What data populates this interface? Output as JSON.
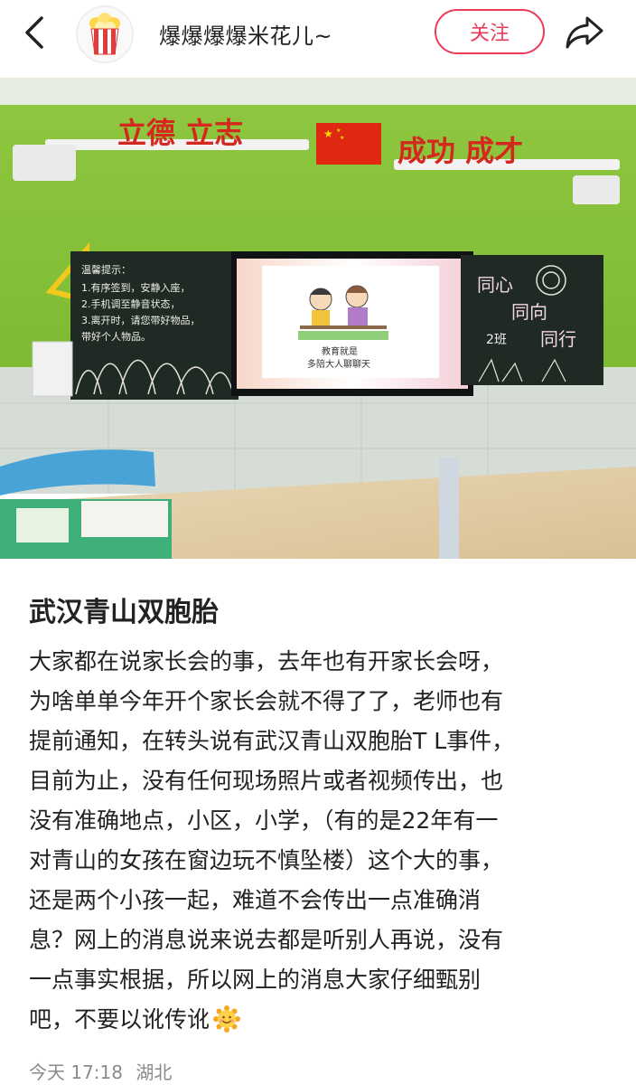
{
  "header": {
    "username": "爆爆爆爆米花儿~",
    "follow_label": "关注",
    "back_icon": "chevron-left-icon",
    "share_icon": "share-arrow-icon",
    "avatar_icon": "popcorn-icon",
    "accent_color": "#ee3a5a"
  },
  "photo": {
    "banner_left": "立德 立志",
    "banner_right": "成功 成才",
    "chalk_left": [
      "温馨提示：",
      "1.有序签到，安静入座，",
      "2.手机调至静音状态，",
      "3.离开时，请您带好物品，",
      "带好个人物品。"
    ],
    "chalk_right": [
      "同心",
      "同向",
      "同行",
      "2班"
    ],
    "screen_caption": [
      "教育就是",
      "多陪大人聊聊天"
    ]
  },
  "post": {
    "title": "武汉青山双胞胎",
    "body_lines": [
      "大家都在说家长会的事，去年也有开家长会呀，",
      "为啥单单今年开个家长会就不得了了，老师也有",
      "提前通知，在转头说有武汉青山双胞胎T L事件，",
      "目前为止，没有任何现场照片或者视频传出，也",
      "没有准确地点，小区，小学，（有的是22年有一",
      "对青山的女孩在窗边玩不慎坠楼）这个大的事，",
      "还是两个小孩一起，难道不会传出一点准确消",
      "息？网上的消息说来说去都是听别人再说，没有",
      "一点事实根据，所以网上的消息大家仔细甄别",
      "吧，不要以讹传讹"
    ],
    "emoji_icon": "smiling-sun-emoji-icon"
  },
  "meta": {
    "date": "今天 17:18",
    "location": "湖北"
  }
}
